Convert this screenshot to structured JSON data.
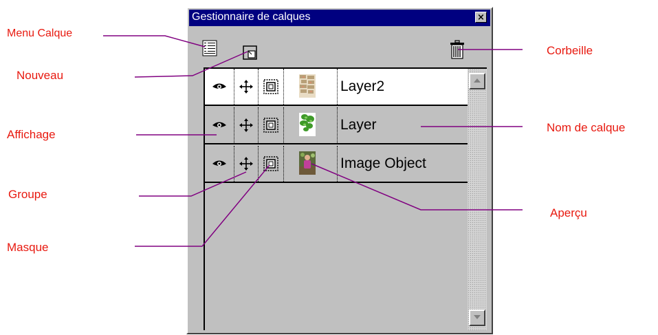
{
  "panel": {
    "title": "Gestionnaire de calques",
    "close_glyph": "×"
  },
  "toolbar": {
    "menu_icon": "layer-menu-icon",
    "new_icon": "new-layer-icon",
    "trash_icon": "trash-icon"
  },
  "layers": [
    {
      "name": "Layer2",
      "selected": true,
      "thumb": "brick-texture"
    },
    {
      "name": "Layer",
      "selected": false,
      "thumb": "green-leaves"
    },
    {
      "name": "Image Object",
      "selected": false,
      "thumb": "photo-person"
    }
  ],
  "callouts": {
    "menu": "Menu Calque",
    "nouveau": "Nouveau",
    "affichage": "Affichage",
    "groupe": "Groupe",
    "masque": "Masque",
    "corbeille": "Corbeille",
    "nom": "Nom de calque",
    "apercu": "Aperçu"
  },
  "colors": {
    "callout_text": "#e8190f",
    "leader_line": "#800080",
    "titlebar": "#000080",
    "panel_face": "#c0c0c0"
  }
}
